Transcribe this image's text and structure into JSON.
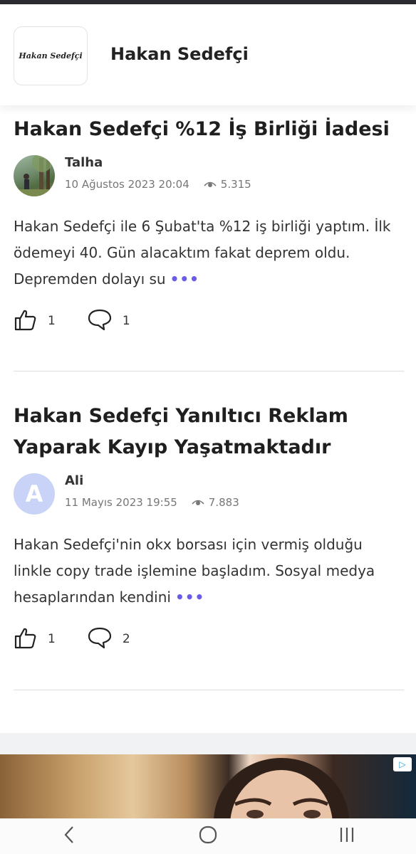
{
  "header": {
    "logo_text": "Hakan Sedefçi",
    "brand_name": "Hakan Sedefçi"
  },
  "posts": [
    {
      "title": "Hakan Sedefçi %12 İş Birliği İadesi",
      "author": "Talha",
      "date": "10 Ağustos 2023 20:04",
      "views": "5.315",
      "excerpt": "Hakan Sedefçi ile 6 Şubat'ta %12 iş birliği yaptım. İlk ödemeyi 40. Gün alacaktım fakat deprem oldu. Depremden dolayı su",
      "more": "•••",
      "likes": "1",
      "comments": "1"
    },
    {
      "title": "Hakan Sedefçi Yanıltıcı Reklam Yaparak Kayıp Yaşatmaktadır",
      "author": "Ali",
      "avatar_letter": "A",
      "date": "11 Mayıs 2023 19:55",
      "views": "7.883",
      "excerpt": "Hakan Sedefçi'nin okx borsası için vermiş olduğu linkle copy trade işlemine başladım. Sosyal medya hesaplarından kendini",
      "more": "•••",
      "likes": "1",
      "comments": "2"
    }
  ],
  "ad": {
    "badge": "▷"
  },
  "icons": {
    "like": "thumbs-up-icon",
    "comment": "comment-bubble-icon",
    "views": "eye-icon",
    "nav_back": "chevron-left-icon",
    "nav_home": "home-circle-icon",
    "nav_recent": "recent-apps-icon"
  },
  "colors": {
    "accent": "#6b5ce7",
    "avatar_letter_bg": "#c9d3f7"
  }
}
